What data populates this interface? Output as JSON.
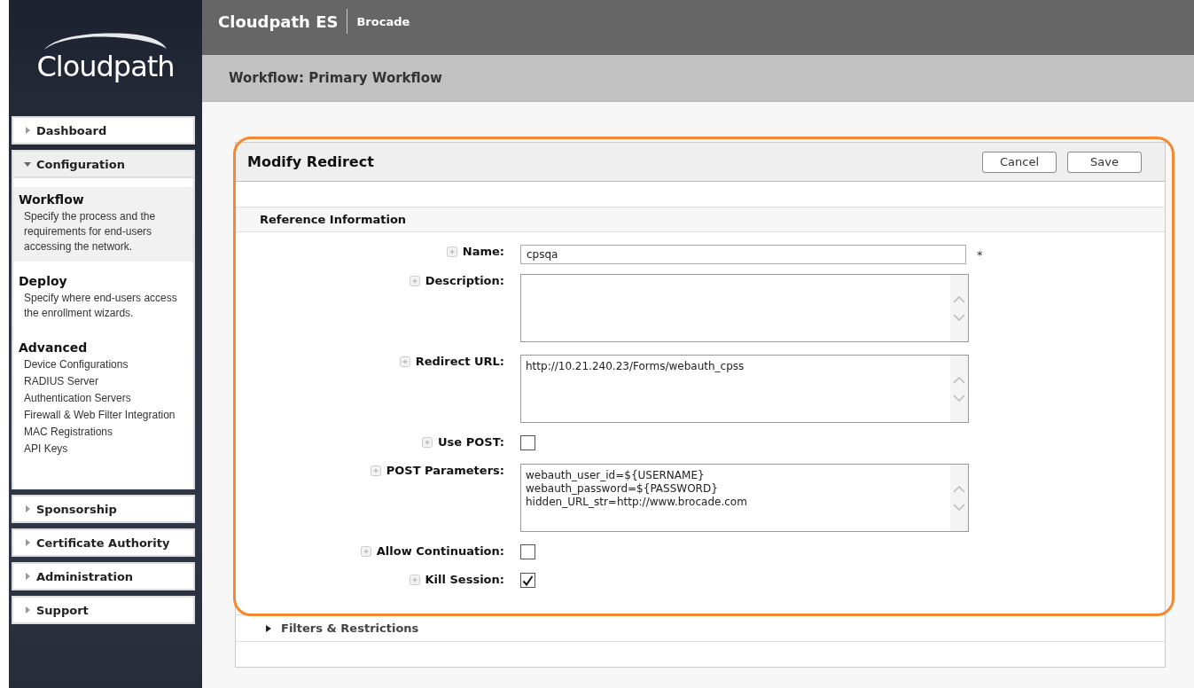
{
  "logo": {
    "text": "Cloudpath"
  },
  "header": {
    "product": "Cloudpath ES",
    "vendor": "Brocade"
  },
  "page_title": "Workflow: Primary Workflow",
  "nav": [
    {
      "label": "Dashboard",
      "expanded": false
    },
    {
      "label": "Configuration",
      "expanded": true,
      "sections": [
        {
          "title": "Workflow",
          "selected": true,
          "description": "Specify the process and the requirements for end-users accessing the network."
        },
        {
          "title": "Deploy",
          "selected": false,
          "description": "Specify where end-users access the enrollment wizards."
        },
        {
          "title": "Advanced",
          "selected": false,
          "links": [
            "Device Configurations",
            "RADIUS Server",
            "Authentication Servers",
            "Firewall & Web Filter Integration",
            "MAC Registrations",
            "API Keys"
          ]
        }
      ]
    },
    {
      "label": "Sponsorship",
      "expanded": false
    },
    {
      "label": "Certificate Authority",
      "expanded": false
    },
    {
      "label": "Administration",
      "expanded": false
    },
    {
      "label": "Support",
      "expanded": false
    }
  ],
  "form": {
    "title": "Modify Redirect",
    "buttons": [
      "Cancel",
      "Save"
    ],
    "section": "Reference Information",
    "fields": [
      {
        "kind": "text",
        "label": "Name:",
        "value": "cpsqa",
        "required": "*"
      },
      {
        "kind": "textarea",
        "label": "Description:"
      },
      {
        "kind": "textarea",
        "label": "Redirect URL:",
        "value": "http://10.21.240.23/Forms/webauth_cpss"
      },
      {
        "kind": "checkbox",
        "label": "Use POST:",
        "checked": false
      },
      {
        "kind": "textarea",
        "label": "POST Parameters:",
        "value": "webauth_user_id=${USERNAME}\nwebauth_password=${PASSWORD}\nhidden_URL_str=http://www.brocade.com"
      },
      {
        "kind": "checkbox",
        "label": "Allow Continuation:",
        "checked": false
      },
      {
        "kind": "checkbox",
        "label": "Kill Session:",
        "checked": true
      }
    ],
    "collapsed_section": {
      "label": "Filters & Restrictions",
      "expanded": false
    }
  }
}
